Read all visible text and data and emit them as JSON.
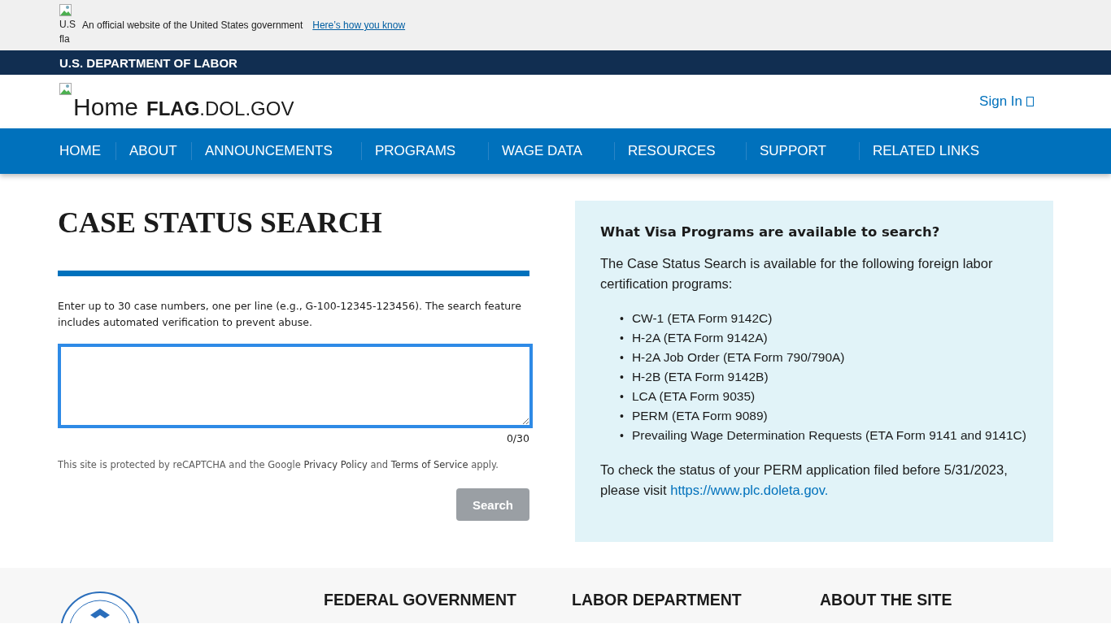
{
  "gov_banner": {
    "flag_alt": [
      "U.S",
      "fla"
    ],
    "text": "An official website of the United States government",
    "link": "Here’s how you know"
  },
  "agency_bar": {
    "title": "U.S. DEPARTMENT OF LABOR"
  },
  "header": {
    "logo_alt": "Home",
    "site_bold": "FLAG",
    "site_rest": ".DOL.GOV",
    "sign_in": "Sign In"
  },
  "nav": [
    {
      "label": "HOME"
    },
    {
      "label": "ABOUT"
    },
    {
      "label": "ANNOUNCEMENTS"
    },
    {
      "label": "PROGRAMS"
    },
    {
      "label": "WAGE DATA"
    },
    {
      "label": "RESOURCES"
    },
    {
      "label": "SUPPORT"
    },
    {
      "label": "RELATED LINKS"
    }
  ],
  "search": {
    "title": "CASE STATUS SEARCH",
    "instructions": "Enter up to 30 case numbers, one per line (e.g., G-100-12345-123456). The search feature includes automated verification to prevent abuse.",
    "counter": "0/30",
    "recaptcha": [
      "This site is protected by reCAPTCHA and the Google ",
      "Privacy Policy",
      " and ",
      "Terms of Service",
      " apply."
    ],
    "button": {
      "label": "Search",
      "disabled": true
    }
  },
  "info": {
    "title": "What Visa Programs are available to search?",
    "bullet": "•",
    "intro": "The Case Status Search is available for the following foreign labor certification programs:",
    "programs": [
      "CW-1 (ETA Form 9142C)",
      "H-2A (ETA Form 9142A)",
      "H-2A Job Order (ETA Form 790/790A)",
      "H-2B (ETA Form 9142B)",
      "LCA (ETA Form 9035)",
      "PERM (ETA Form 9089)",
      "Prevailing Wage Determination Requests (ETA Form 9141 and 9141C)"
    ],
    "perm_note": "To check the status of your PERM application filed before 5/31/2023, please visit ",
    "perm_link": "https://www.plc.doleta.gov."
  },
  "footer": {
    "columns": [
      "FEDERAL GOVERNMENT",
      "LABOR DEPARTMENT",
      "ABOUT THE SITE"
    ]
  }
}
